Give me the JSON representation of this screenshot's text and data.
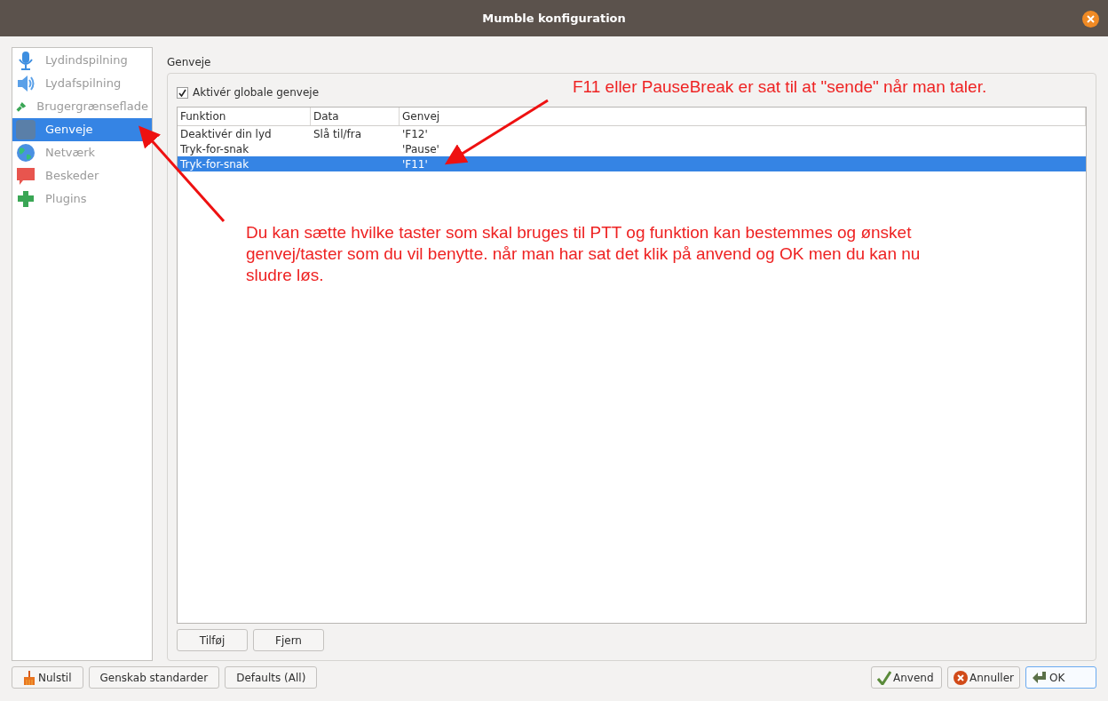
{
  "window": {
    "title": "Mumble konfiguration"
  },
  "sidebar": {
    "items": [
      {
        "label": "Lydindspilning",
        "kind": "microphone",
        "selected": false
      },
      {
        "label": "Lydafspilning",
        "kind": "speaker",
        "selected": false
      },
      {
        "label": "Brugergrænseflade",
        "kind": "brush",
        "selected": false
      },
      {
        "label": "Genveje",
        "kind": "keyboard",
        "selected": true
      },
      {
        "label": "Netværk",
        "kind": "globe",
        "selected": false
      },
      {
        "label": "Beskeder",
        "kind": "message",
        "selected": false
      },
      {
        "label": "Plugins",
        "kind": "puzzle",
        "selected": false
      }
    ]
  },
  "section": {
    "title": "Genveje",
    "checkbox": {
      "label": "Aktivér globale genveje",
      "checked": true
    },
    "table": {
      "columns": [
        "Funktion",
        "Data",
        "Genvej"
      ],
      "rows": [
        {
          "cells": [
            "Deaktivér din lyd",
            "Slå til/fra",
            "'F12'"
          ],
          "selected": false
        },
        {
          "cells": [
            "Tryk-for-snak",
            "",
            "'Pause'"
          ],
          "selected": false
        },
        {
          "cells": [
            "Tryk-for-snak",
            "",
            "'F11'"
          ],
          "selected": true
        }
      ]
    },
    "buttons": [
      "Tilføj",
      "Fjern"
    ]
  },
  "footer": {
    "left_buttons": [
      {
        "label": "Nulstil",
        "kind": "reset"
      },
      {
        "label": "Genskab standarder",
        "kind": "plain"
      },
      {
        "label": "Defaults (All)",
        "kind": "plain"
      }
    ],
    "right_buttons": [
      {
        "label": "Anvend",
        "kind": "apply",
        "default": false
      },
      {
        "label": "Annuller",
        "kind": "cancel",
        "default": false
      },
      {
        "label": "OK",
        "kind": "ok",
        "default": true
      }
    ]
  },
  "annotations": [
    "F11 eller PauseBreak er sat til at \"sende\" når man taler.",
    "Du kan sætte hvilke taster som skal bruges til PTT og funktion kan bestemmes og ønsket genvej/taster som du vil benytte.  når man har sat det klik på anvend og OK men du kan nu sludre løs."
  ]
}
